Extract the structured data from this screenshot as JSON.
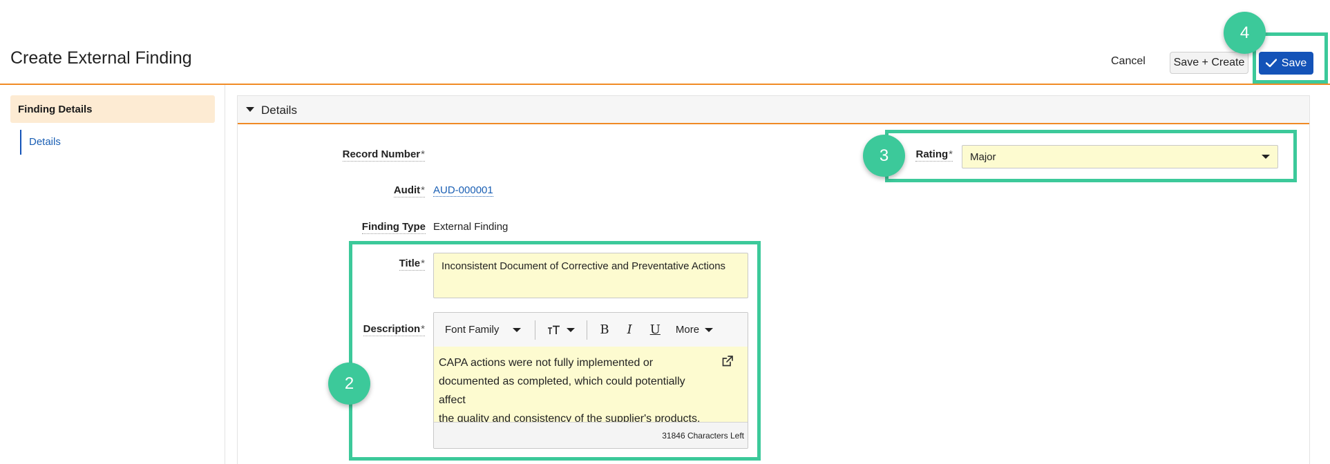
{
  "header": {
    "title": "Create External Finding",
    "cancel_label": "Cancel",
    "save_create_label": "Save + Create",
    "save_label": "Save"
  },
  "sidebar": {
    "section_label": "Finding Details",
    "items": [
      {
        "label": "Details",
        "active": true
      }
    ]
  },
  "section": {
    "title": "Details",
    "expanded": true
  },
  "fields": {
    "record_number": {
      "label": "Record Number",
      "required": "*",
      "value": ""
    },
    "audit": {
      "label": "Audit",
      "required": "*",
      "value": "AUD-000001"
    },
    "finding_type": {
      "label": "Finding Type",
      "value": "External Finding"
    },
    "title": {
      "label": "Title",
      "required": "*",
      "value": "Inconsistent Document of Corrective and Preventative Actions"
    },
    "description": {
      "label": "Description",
      "required": "*",
      "lines": [
        "CAPA actions were not fully implemented or",
        "documented as completed, which could potentially affect",
        "the quality and consistency of the supplier's products."
      ],
      "chars_left": "31846 Characters Left"
    },
    "rating": {
      "label": "Rating",
      "required": "*",
      "value": "Major"
    }
  },
  "editor_toolbar": {
    "font_family_label": "Font Family",
    "font_size_icon": "font-size-icon",
    "bold_glyph": "B",
    "italic_glyph": "I",
    "underline_glyph": "U",
    "more_label": "More"
  },
  "callouts": {
    "description_badge": "2",
    "rating_badge": "3",
    "save_badge": "4",
    "color": "#3cc99a"
  },
  "colors": {
    "accent": "#f08a24",
    "primary": "#1453b8",
    "field_fill": "#fdfbd0",
    "sidebar_active": "#fdebd3"
  }
}
